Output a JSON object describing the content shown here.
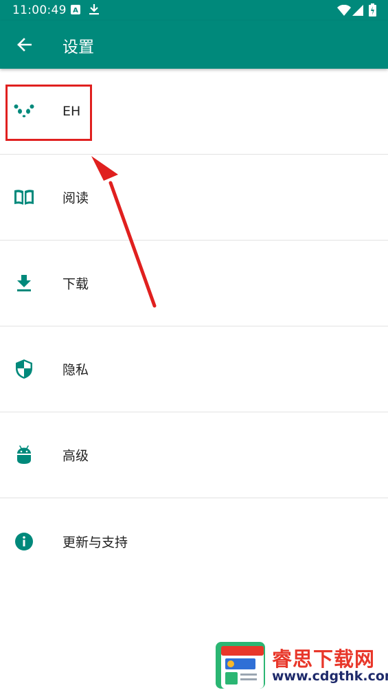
{
  "status_bar": {
    "time": "11:00:49",
    "icons": [
      "a-notification-icon",
      "download-notification-icon",
      "wifi-icon",
      "signal-icon",
      "battery-charging-icon"
    ]
  },
  "app_bar": {
    "title": "设置",
    "back_icon": "arrow-back-icon",
    "background_color": "#00897b"
  },
  "settings": [
    {
      "label": "EH",
      "icon": "panda-icon"
    },
    {
      "label": "阅读",
      "icon": "book-icon"
    },
    {
      "label": "下载",
      "icon": "download-icon"
    },
    {
      "label": "隐私",
      "icon": "shield-icon"
    },
    {
      "label": "高级",
      "icon": "android-icon"
    },
    {
      "label": "更新与支持",
      "icon": "info-icon"
    }
  ],
  "annotation": {
    "color": "#e0201f",
    "highlighted_item": "EH"
  },
  "watermark": {
    "title": "睿思下载网",
    "url": "www.cdgthk.com"
  },
  "colors": {
    "accent": "#00897b",
    "icon": "#00897b",
    "text": "#212121"
  }
}
